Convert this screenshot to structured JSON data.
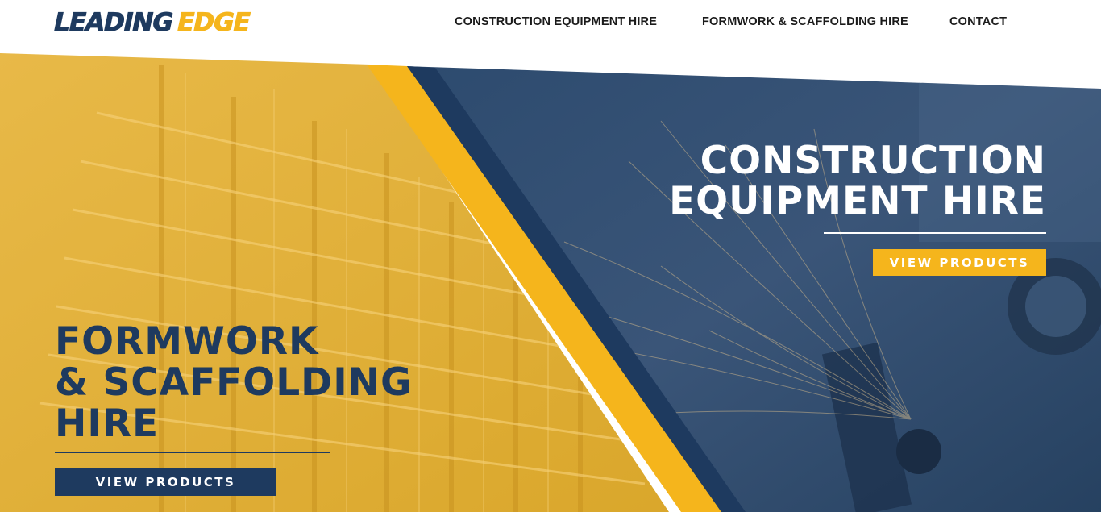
{
  "brand": {
    "logo_part1": "LEADING",
    "logo_part2": "EDGE",
    "navy": "#1e3a5f",
    "yellow": "#f5b51c"
  },
  "nav": {
    "items": [
      {
        "label": "CONSTRUCTION EQUIPMENT HIRE"
      },
      {
        "label": "FORMWORK & SCAFFOLDING HIRE"
      },
      {
        "label": "CONTACT"
      }
    ]
  },
  "hero": {
    "right": {
      "title_lines": [
        "CONSTRUCTION",
        "EQUIPMENT HIRE"
      ],
      "button_label": "VIEW PRODUCTS"
    },
    "left": {
      "title_lines": [
        "FORMWORK",
        "& SCAFFOLDING",
        "HIRE"
      ],
      "button_label": "VIEW PRODUCTS"
    }
  }
}
